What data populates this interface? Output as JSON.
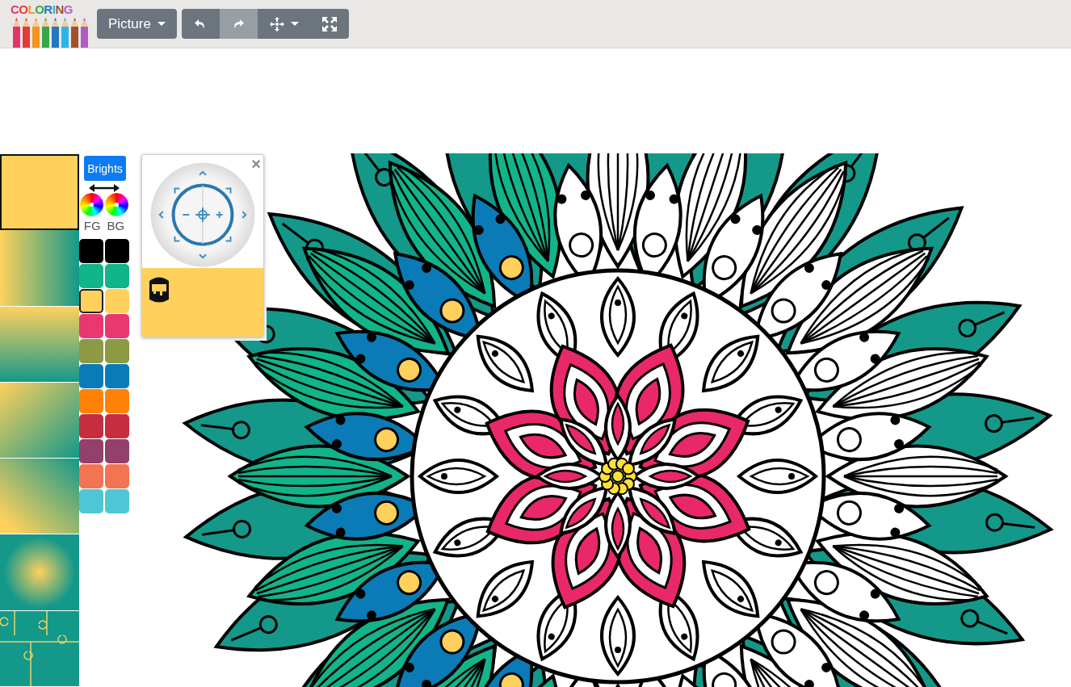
{
  "logo": {
    "letters": [
      {
        "char": "C",
        "color": "#e4326a"
      },
      {
        "char": "O",
        "color": "#e23a3a"
      },
      {
        "char": "L",
        "color": "#f39322"
      },
      {
        "char": "O",
        "color": "#3aa64a"
      },
      {
        "char": "R",
        "color": "#1f78c1"
      },
      {
        "char": "I",
        "color": "#2bb3e6"
      },
      {
        "char": "N",
        "color": "#a0522d"
      },
      {
        "char": "G",
        "color": "#b05cc6"
      }
    ]
  },
  "toolbar": {
    "picture_menu": {
      "label": "Picture"
    },
    "tools": [
      {
        "kind": "undo",
        "disabled": false
      },
      {
        "kind": "redo",
        "disabled": true
      },
      {
        "kind": "move",
        "disabled": false
      },
      {
        "kind": "fullscreen",
        "disabled": false
      }
    ]
  },
  "fill_styles": [
    {
      "kind": "solid",
      "selected": true
    },
    {
      "kind": "horizontal",
      "selected": false
    },
    {
      "kind": "vertical",
      "selected": false
    },
    {
      "kind": "diagonal",
      "selected": false
    },
    {
      "kind": "diagonal-up",
      "selected": false
    },
    {
      "kind": "radial",
      "selected": false
    },
    {
      "kind": "puzzle",
      "selected": false
    }
  ],
  "palette": {
    "name": "Brights",
    "fg_label": "FG",
    "bg_label": "BG",
    "colors": [
      {
        "color": "#000000",
        "selected": false
      },
      {
        "color": "#12b48a",
        "selected": false
      },
      {
        "color": "#ffd15c",
        "selected": true
      },
      {
        "color": "#e8386f",
        "selected": false
      },
      {
        "color": "#8c9a44",
        "selected": false
      },
      {
        "color": "#0a7bb6",
        "selected": false
      },
      {
        "color": "#ff8207",
        "selected": false
      },
      {
        "color": "#c62d3f",
        "selected": false
      },
      {
        "color": "#93406a",
        "selected": false
      },
      {
        "color": "#f27453",
        "selected": false
      },
      {
        "color": "#4ec6d6",
        "selected": false
      }
    ]
  },
  "navigator": {
    "close": "×"
  }
}
